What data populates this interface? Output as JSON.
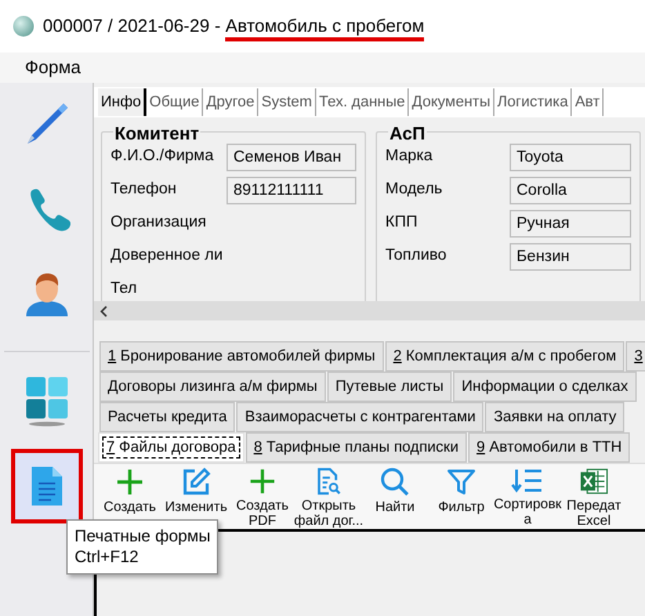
{
  "window": {
    "title_prefix": "000007 / 2021-06-29 - ",
    "title_main": "Автомобиль с пробегом"
  },
  "menu": [
    "Форма"
  ],
  "sidebar": {
    "items": [
      {
        "kind": "pen",
        "selected": false
      },
      {
        "kind": "phone",
        "selected": false
      },
      {
        "kind": "person",
        "selected": false
      },
      {
        "kind": "tiles",
        "selected": false
      },
      {
        "kind": "document",
        "selected": true
      }
    ]
  },
  "top_tabs": [
    {
      "label": "Инфо",
      "selected": true
    },
    {
      "label": "Общие",
      "selected": false
    },
    {
      "label": "Другое",
      "selected": false
    },
    {
      "label": "System",
      "selected": false
    },
    {
      "label": "Тех. данные",
      "selected": false
    },
    {
      "label": "Документы",
      "selected": false
    },
    {
      "label": "Логистика",
      "selected": false
    },
    {
      "label": "Авт",
      "selected": false
    }
  ],
  "groups": [
    {
      "title": "Комитент",
      "fields": [
        {
          "label": "Ф.И.О./Фирма",
          "value": "Семенов Иван"
        },
        {
          "label": "Телефон",
          "value": "89112111111"
        },
        {
          "label": "Организация"
        },
        {
          "label": "Доверенное ли"
        },
        {
          "label": "Тел"
        }
      ]
    },
    {
      "title": "АсП",
      "fields": [
        {
          "label": "Марка",
          "value": "Toyota"
        },
        {
          "label": "Модель",
          "value": "Corolla"
        },
        {
          "label": "КПП",
          "value": "Ручная"
        },
        {
          "label": "Топливо",
          "value": "Бензин"
        }
      ]
    }
  ],
  "tab_rows": [
    [
      {
        "key": "1",
        "label": " Бронирование автомобилей фирмы",
        "selected": false
      },
      {
        "key": "2",
        "label": " Комплектация а/м с пробегом",
        "selected": false
      },
      {
        "key": "3",
        "selected": false
      }
    ],
    [
      {
        "label": "Договоры лизинга а/м фирмы",
        "selected": false
      },
      {
        "label": "Путевые листы",
        "selected": false
      },
      {
        "label": "Информации о сделках",
        "selected": false
      }
    ],
    [
      {
        "label": "Расчеты кредита",
        "selected": false
      },
      {
        "label": "Взаиморасчеты с контрагентами",
        "selected": false
      },
      {
        "label": "Заявки на оплату",
        "selected": false
      }
    ],
    [
      {
        "key": "7",
        "label": " Файлы договора",
        "selected": true
      },
      {
        "key": "8",
        "label": " Тарифные планы подписки",
        "selected": false
      },
      {
        "key": "9",
        "label": " Автомобили в ТТН",
        "selected": false
      }
    ]
  ],
  "toolbar": [
    {
      "kind": "plus",
      "lines": [
        "Создать"
      ]
    },
    {
      "kind": "edit",
      "lines": [
        "Изменить"
      ]
    },
    {
      "kind": "plus",
      "lines": [
        "Создать",
        "PDF"
      ]
    },
    {
      "kind": "docsearch",
      "lines": [
        "Открыть",
        "файл дог..."
      ]
    },
    {
      "kind": "search",
      "lines": [
        "Найти"
      ]
    },
    {
      "kind": "filter",
      "lines": [
        "Фильтр"
      ]
    },
    {
      "kind": "sort",
      "lines": [
        "Сортировк",
        "а"
      ]
    },
    {
      "kind": "excel",
      "lines": [
        "Передат",
        "Excel"
      ]
    }
  ],
  "tooltip": {
    "lines": [
      "Печатные формы",
      "Ctrl+F12"
    ]
  }
}
